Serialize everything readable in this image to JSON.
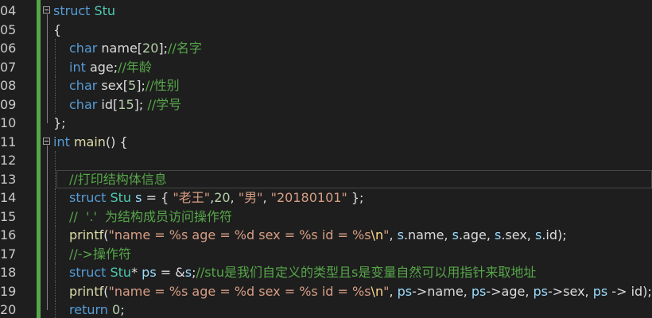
{
  "editor": {
    "lines": [
      {
        "num": "04",
        "fold": true,
        "tokens": [
          {
            "t": "struct",
            "c": "kw"
          },
          {
            "t": " ",
            "c": "pl"
          },
          {
            "t": "Stu",
            "c": "ty"
          }
        ]
      },
      {
        "num": "05",
        "tokens": [
          {
            "t": "{",
            "c": "pl"
          }
        ]
      },
      {
        "num": "06",
        "indent": 1,
        "tokens": [
          {
            "t": "char",
            "c": "kw"
          },
          {
            "t": " name[",
            "c": "pl"
          },
          {
            "t": "20",
            "c": "nm"
          },
          {
            "t": "];",
            "c": "pl"
          },
          {
            "t": "//名字",
            "c": "cm"
          }
        ]
      },
      {
        "num": "07",
        "indent": 1,
        "tokens": [
          {
            "t": "int",
            "c": "kw"
          },
          {
            "t": " age;",
            "c": "pl"
          },
          {
            "t": "//年龄",
            "c": "cm"
          }
        ]
      },
      {
        "num": "08",
        "indent": 1,
        "tokens": [
          {
            "t": "char",
            "c": "kw"
          },
          {
            "t": " sex[",
            "c": "pl"
          },
          {
            "t": "5",
            "c": "nm"
          },
          {
            "t": "];",
            "c": "pl"
          },
          {
            "t": "//性别",
            "c": "cm"
          }
        ]
      },
      {
        "num": "09",
        "indent": 1,
        "tokens": [
          {
            "t": "char",
            "c": "kw"
          },
          {
            "t": " id[",
            "c": "pl"
          },
          {
            "t": "15",
            "c": "nm"
          },
          {
            "t": "]; ",
            "c": "pl"
          },
          {
            "t": "//学号",
            "c": "cm"
          }
        ]
      },
      {
        "num": "10",
        "tokens": [
          {
            "t": "};",
            "c": "pl"
          }
        ]
      },
      {
        "num": "11",
        "fold": true,
        "tokens": [
          {
            "t": "int",
            "c": "kw"
          },
          {
            "t": " ",
            "c": "pl"
          },
          {
            "t": "main",
            "c": "fn"
          },
          {
            "t": "() {",
            "c": "pl"
          }
        ]
      },
      {
        "num": "12",
        "indent": 1,
        "tokens": []
      },
      {
        "num": "13",
        "indent": 1,
        "highlight": true,
        "tokens": [
          {
            "t": "//打印结构体信息",
            "c": "cm"
          }
        ]
      },
      {
        "num": "14",
        "indent": 1,
        "tokens": [
          {
            "t": "struct",
            "c": "kw"
          },
          {
            "t": " ",
            "c": "pl"
          },
          {
            "t": "Stu",
            "c": "ty"
          },
          {
            "t": " ",
            "c": "pl"
          },
          {
            "t": "s",
            "c": "vr"
          },
          {
            "t": " = { ",
            "c": "pl"
          },
          {
            "t": "\"老王\"",
            "c": "st"
          },
          {
            "t": ",",
            "c": "pl"
          },
          {
            "t": "20",
            "c": "nm"
          },
          {
            "t": ", ",
            "c": "pl"
          },
          {
            "t": "\"男\"",
            "c": "st"
          },
          {
            "t": ", ",
            "c": "pl"
          },
          {
            "t": "\"20180101\"",
            "c": "st"
          },
          {
            "t": " };",
            "c": "pl"
          }
        ]
      },
      {
        "num": "15",
        "indent": 1,
        "tokens": [
          {
            "t": "//  '.'  为结构成员访问操作符",
            "c": "cm"
          }
        ]
      },
      {
        "num": "16",
        "indent": 1,
        "tokens": [
          {
            "t": "printf",
            "c": "fn"
          },
          {
            "t": "(",
            "c": "pl"
          },
          {
            "t": "\"name = %s age = %d sex = %s id = %s",
            "c": "st"
          },
          {
            "t": "\\n",
            "c": "es"
          },
          {
            "t": "\"",
            "c": "st"
          },
          {
            "t": ", ",
            "c": "pl"
          },
          {
            "t": "s",
            "c": "vr"
          },
          {
            "t": ".name, ",
            "c": "pl"
          },
          {
            "t": "s",
            "c": "vr"
          },
          {
            "t": ".age, ",
            "c": "pl"
          },
          {
            "t": "s",
            "c": "vr"
          },
          {
            "t": ".sex, ",
            "c": "pl"
          },
          {
            "t": "s",
            "c": "vr"
          },
          {
            "t": ".id);",
            "c": "pl"
          }
        ]
      },
      {
        "num": "17",
        "indent": 1,
        "tokens": [
          {
            "t": "//->操作符",
            "c": "cm"
          }
        ]
      },
      {
        "num": "18",
        "indent": 1,
        "tokens": [
          {
            "t": "struct",
            "c": "kw"
          },
          {
            "t": " ",
            "c": "pl"
          },
          {
            "t": "Stu",
            "c": "ty"
          },
          {
            "t": "* ",
            "c": "pl"
          },
          {
            "t": "ps",
            "c": "vr"
          },
          {
            "t": " = &",
            "c": "pl"
          },
          {
            "t": "s",
            "c": "vr"
          },
          {
            "t": ";",
            "c": "pl"
          },
          {
            "t": "//stu是我们自定义的类型且s是变量自然可以用指针来取地址",
            "c": "cm"
          }
        ]
      },
      {
        "num": "19",
        "indent": 1,
        "tokens": [
          {
            "t": "printf",
            "c": "fn"
          },
          {
            "t": "(",
            "c": "pl"
          },
          {
            "t": "\"name = %s age = %d sex = %s id = %s",
            "c": "st"
          },
          {
            "t": "\\n",
            "c": "es"
          },
          {
            "t": "\"",
            "c": "st"
          },
          {
            "t": ", ",
            "c": "pl"
          },
          {
            "t": "ps",
            "c": "vr"
          },
          {
            "t": "->name, ",
            "c": "pl"
          },
          {
            "t": "ps",
            "c": "vr"
          },
          {
            "t": "->age, ",
            "c": "pl"
          },
          {
            "t": "ps",
            "c": "vr"
          },
          {
            "t": "->sex, ",
            "c": "pl"
          },
          {
            "t": "ps",
            "c": "vr"
          },
          {
            "t": " -> id);",
            "c": "pl"
          }
        ]
      },
      {
        "num": "20",
        "indent": 1,
        "tokens": [
          {
            "t": "return",
            "c": "kw"
          },
          {
            "t": " ",
            "c": "pl"
          },
          {
            "t": "0",
            "c": "nm"
          },
          {
            "t": ";",
            "c": "pl"
          }
        ]
      }
    ]
  }
}
